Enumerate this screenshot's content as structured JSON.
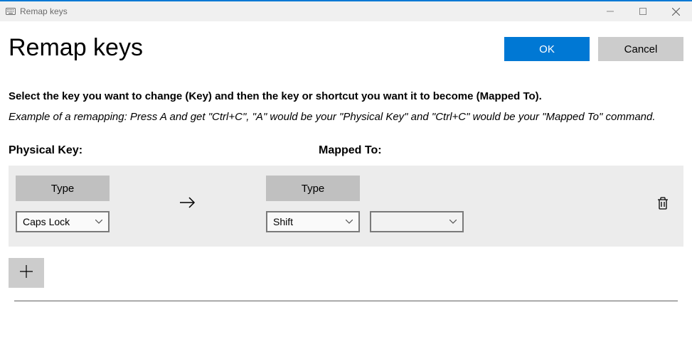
{
  "titlebar": {
    "title": "Remap keys"
  },
  "header": {
    "page_title": "Remap keys",
    "ok_label": "OK",
    "cancel_label": "Cancel"
  },
  "instructions": "Select the key you want to change (Key) and then the key or shortcut you want it to become (Mapped To).",
  "example": "Example of a remapping: Press A and get \"Ctrl+C\", \"A\" would be your \"Physical Key\" and \"Ctrl+C\" would be your \"Mapped To\" command.",
  "columns": {
    "physical": "Physical Key:",
    "mapped": "Mapped To:"
  },
  "row": {
    "type_label": "Type",
    "physical_value": "Caps Lock",
    "mapped_value_1": "Shift",
    "mapped_value_2": ""
  }
}
